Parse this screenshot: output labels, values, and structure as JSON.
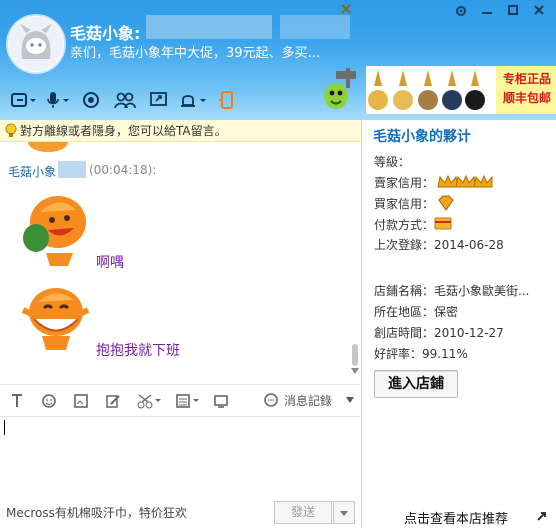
{
  "header": {
    "title": "毛菇小象:",
    "status": "亲们，毛菇小象年中大促，39元起、多买…",
    "icons": [
      "back-icon",
      "microphone-icon",
      "record-icon",
      "contacts-icon",
      "screen-share-icon",
      "bell-icon",
      "mobile-icon"
    ]
  },
  "promo": {
    "line1": "专柜正品",
    "line2": "顺丰包邮"
  },
  "notice": {
    "text": "對方離線或者隱身，您可以給TA留言。"
  },
  "chat": {
    "sender": "毛菇小象",
    "time": "(00:04:18):",
    "messages": [
      {
        "text": "啊喁"
      },
      {
        "text": "抱抱我就下班"
      }
    ]
  },
  "input_toolbar": {
    "history_label": "消息記錄"
  },
  "footer": {
    "ad_text": "Mecross有机棉吸汗巾，特价狂欢",
    "send_label": "發送"
  },
  "shop": {
    "title": "毛菇小象的夥计",
    "level_label": "等級：",
    "seller_credit_label": "賣家信用：",
    "buyer_credit_label": "買家信用：",
    "payment_label": "付款方式：",
    "last_login_label": "上次登錄：",
    "last_login": "2014-06-28",
    "store_name_label": "店鋪名稱：",
    "store_name": "毛菇小象歐美街...",
    "location_label": "所在地區：",
    "location": "保密",
    "open_date_label": "創店時間：",
    "open_date": "2010-12-27",
    "rating_label": "好評率：",
    "rating": "99.11%",
    "enter_label": "進入店鋪",
    "recommend_label": "点击查看本店推荐"
  },
  "colors": {
    "header_top": "#2f9be8",
    "header_bottom": "#a6dcfb",
    "accent_red": "#d51a1a",
    "message_purple": "#7b20a3",
    "shop_title_blue": "#1670b7"
  }
}
